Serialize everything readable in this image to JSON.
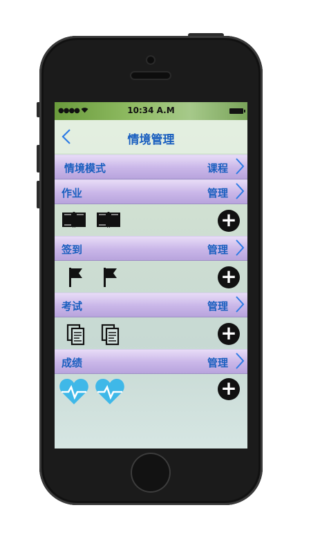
{
  "status_bar": {
    "signal": "●●●● ",
    "time": "10:34 A.M"
  },
  "nav": {
    "back_icon": "chevron-left-icon",
    "title": "情境管理"
  },
  "sections": [
    {
      "label": "情境模式",
      "action": "课程"
    },
    {
      "label": "作业",
      "action": "管理",
      "items": [
        "book-icon",
        "book-icon"
      ]
    },
    {
      "label": "签到",
      "action": "管理",
      "items": [
        "flag-icon",
        "flag-icon"
      ]
    },
    {
      "label": "考试",
      "action": "管理",
      "items": [
        "document-icon",
        "document-icon"
      ]
    },
    {
      "label": "成绩",
      "action": "管理",
      "items": [
        "heartbeat-icon",
        "heartbeat-icon"
      ]
    }
  ],
  "colors": {
    "accent": "#1a5fbf",
    "bar_top": "#e8dcf7",
    "bar_bottom": "#b8a4dd",
    "heart": "#3fb8e8",
    "add_button": "#111111"
  }
}
